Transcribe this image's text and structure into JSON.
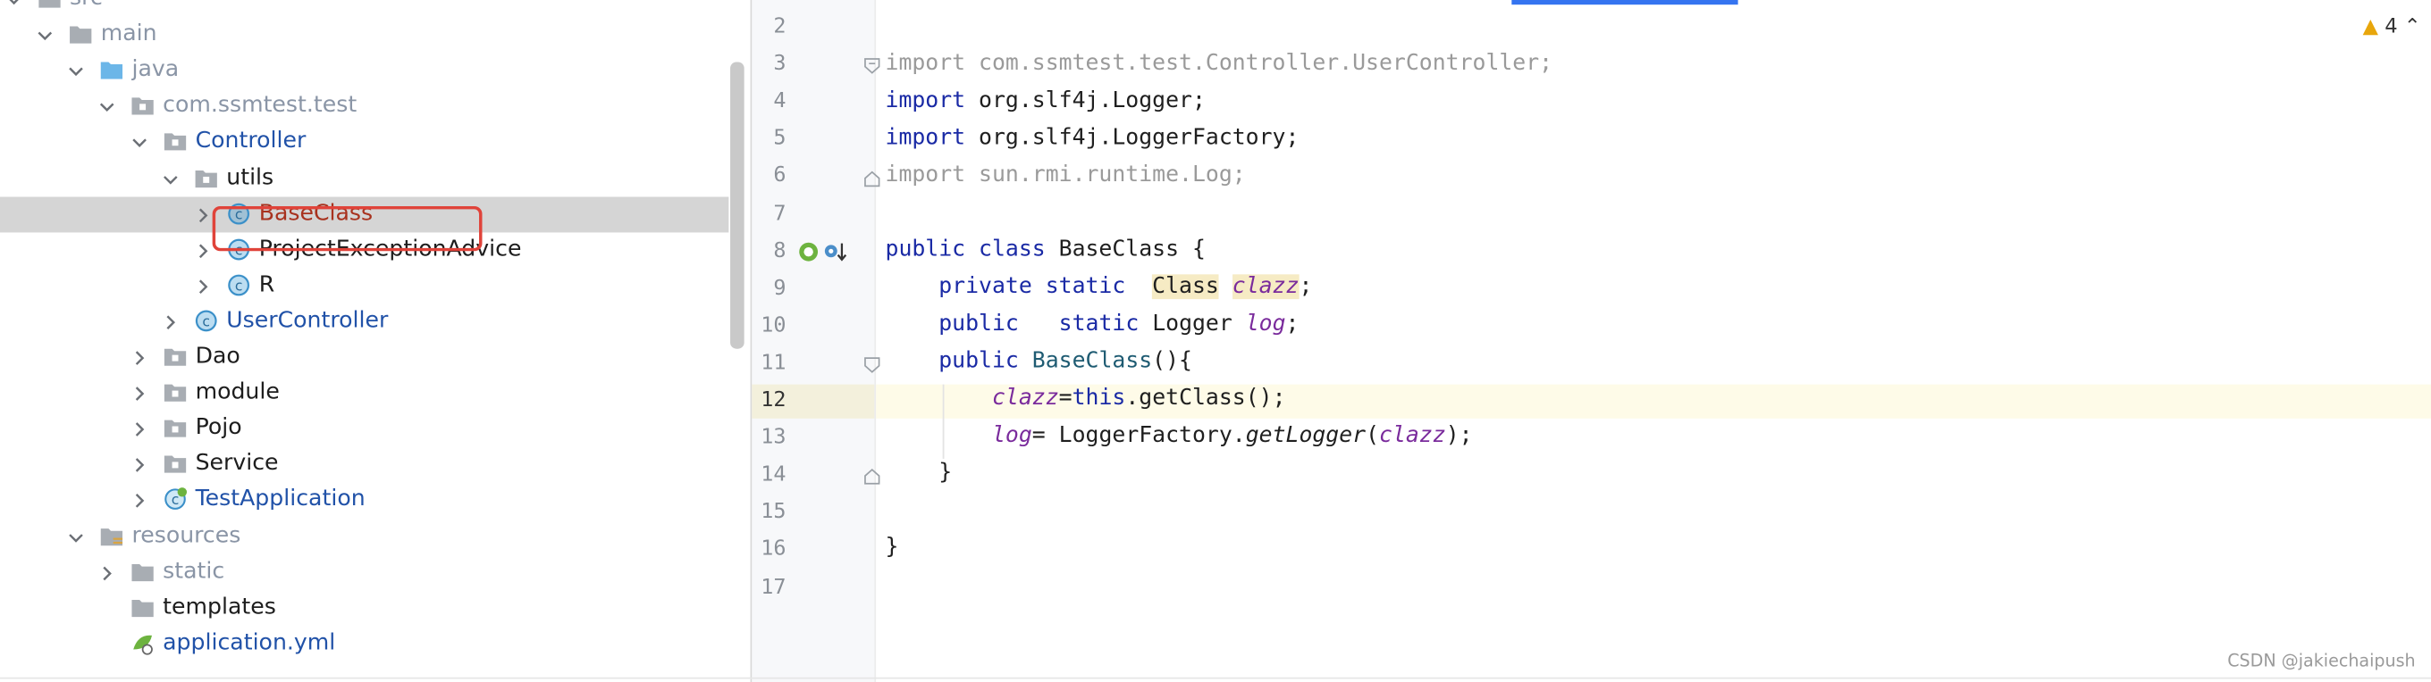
{
  "project_tree": {
    "items": [
      {
        "label": "src",
        "icon": "folder-icon",
        "color": "gray"
      },
      {
        "label": "main",
        "icon": "folder-icon",
        "color": "gray"
      },
      {
        "label": "java",
        "icon": "source-folder-icon",
        "color": "gray"
      },
      {
        "label": "com.ssmtest.test",
        "icon": "package-icon",
        "color": "gray"
      },
      {
        "label": "Controller",
        "icon": "package-icon",
        "color": "blue"
      },
      {
        "label": "utils",
        "icon": "package-icon",
        "color": "black"
      },
      {
        "label": "BaseClass",
        "icon": "class-icon",
        "color": "red",
        "selected": true
      },
      {
        "label": "ProjectExceptionAdvice",
        "icon": "class-icon",
        "color": "black"
      },
      {
        "label": "R",
        "icon": "class-icon",
        "color": "black"
      },
      {
        "label": "UserController",
        "icon": "class-icon",
        "color": "blue"
      },
      {
        "label": "Dao",
        "icon": "package-icon",
        "color": "black"
      },
      {
        "label": "module",
        "icon": "package-icon",
        "color": "black"
      },
      {
        "label": "Pojo",
        "icon": "package-icon",
        "color": "black"
      },
      {
        "label": "Service",
        "icon": "package-icon",
        "color": "black"
      },
      {
        "label": "TestApplication",
        "icon": "spring-boot-class-icon",
        "color": "blue"
      },
      {
        "label": "resources",
        "icon": "resources-folder-icon",
        "color": "gray"
      },
      {
        "label": "static",
        "icon": "folder-icon",
        "color": "gray"
      },
      {
        "label": "templates",
        "icon": "folder-icon",
        "color": "black"
      },
      {
        "label": "application.yml",
        "icon": "yaml-config-icon",
        "color": "blue"
      }
    ]
  },
  "editor": {
    "line_numbers": [
      "2",
      "3",
      "4",
      "5",
      "6",
      "7",
      "8",
      "9",
      "10",
      "11",
      "12",
      "13",
      "14",
      "15",
      "16",
      "17"
    ],
    "current_line": "12",
    "warnings_count": "4",
    "code": {
      "l3_kw": "import",
      "l3_rest": " com.ssmtest.test.Controller.UserController;",
      "l4_kw": "import",
      "l4_rest": " org.slf4j.Logger;",
      "l5_kw": "import",
      "l5_rest": " org.slf4j.LoggerFactory;",
      "l6_kw": "import",
      "l6_rest": " sun.rmi.runtime.Log;",
      "l8_kw": "public class",
      "l8_name": " BaseClass ",
      "l8_brace": "{",
      "l9_kw": "private static",
      "l9_type": "Class",
      "l9_field": "clazz",
      "l9_end": ";",
      "l10_kw1": "public",
      "l10_kw2": "static",
      "l10_type": " Logger ",
      "l10_field": "log",
      "l10_end": ";",
      "l11_kw": "public",
      "l11_name": "BaseClass",
      "l11_end": "(){",
      "l12_field": "clazz",
      "l12_eq": "=",
      "l12_kw": "this",
      "l12_end": ".getClass();",
      "l13_field": "log",
      "l13_eq": "= LoggerFactory.",
      "l13_method": "getLogger",
      "l13_paren": "(",
      "l13_arg": "clazz",
      "l13_end": ");",
      "l14": "}",
      "l16": "}"
    }
  },
  "watermark": "CSDN @jakiechaipush",
  "colors": {
    "selection_border": "#e0433a",
    "keyword": "#1a2aa5",
    "field": "#7a2b9c",
    "accent_tab": "#3574f0"
  }
}
